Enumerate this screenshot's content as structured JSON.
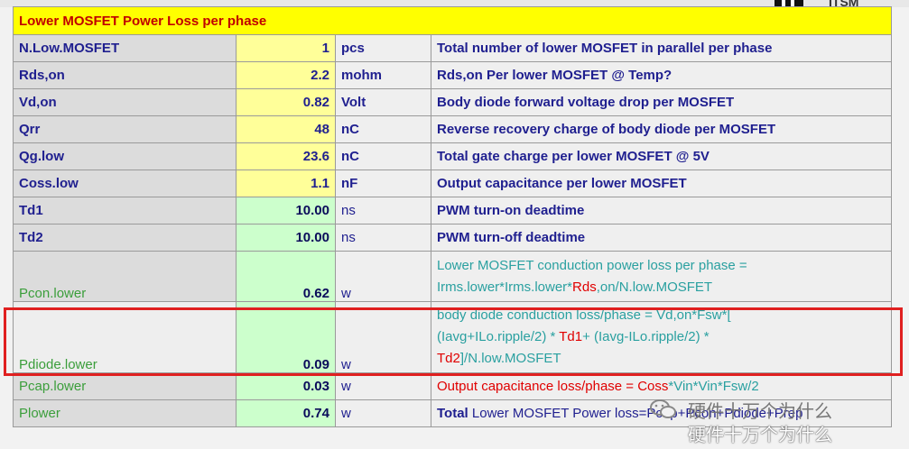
{
  "header": {
    "logo_text": "ITSM"
  },
  "table": {
    "title": "Lower MOSFET Power Loss per phase",
    "rows": [
      {
        "name": "N.Low.MOSFET",
        "value": "1",
        "unit": "pcs",
        "desc": "Total number of lower MOSFET in parallel per phase"
      },
      {
        "name": "Rds,on",
        "value": "2.2",
        "unit": "mohm",
        "desc": "Rds,on Per lower MOSFET @ Temp?"
      },
      {
        "name": "Vd,on",
        "value": "0.82",
        "unit": "Volt",
        "desc": "Body diode forward voltage drop per MOSFET"
      },
      {
        "name": "Qrr",
        "value": "48",
        "unit": "nC",
        "desc": "Reverse recovery charge of body diode per MOSFET"
      },
      {
        "name": "Qg.low",
        "value": "23.6",
        "unit": "nC",
        "desc": "Total gate charge per lower MOSFET @ 5V"
      },
      {
        "name": "Coss.low",
        "value": "1.1",
        "unit": "nF",
        "desc": "Output capacitance per lower MOSFET"
      },
      {
        "name": "Td1",
        "value": "10.00",
        "unit": "ns",
        "desc": "PWM turn-on deadtime"
      },
      {
        "name": "Td2",
        "value": "10.00",
        "unit": "ns",
        "desc": "PWM turn-off deadtime"
      }
    ],
    "pcon": {
      "name": "Pcon.lower",
      "value": "0.62",
      "unit": "w",
      "line1": "Lower MOSFET conduction power loss per phase =",
      "line2_a": "Irms.lower*Irms.lower*",
      "line2_red": "Rds",
      "line2_b": ",on/N.low.MOSFET"
    },
    "pdiode": {
      "name": "Pdiode.lower",
      "value": "0.09",
      "unit": "w",
      "line1": "body diode conduction loss/phase = Vd,on*Fsw*[",
      "line2_a": "(Iavg+ILo.ripple/2) * ",
      "line2_red": "Td1",
      "line2_b": "+ (Iavg-ILo.ripple/2) *",
      "line3_red": "Td2",
      "line3_b": "]/N.low.MOSFET"
    },
    "pcap": {
      "name": "Pcap.lower",
      "value": "0.03",
      "unit": "w",
      "desc_red": "Output capacitance loss/phase = Coss",
      "desc_b": "*Vin*Vin*Fsw/2"
    },
    "plower": {
      "name": "Plower",
      "value": "0.74",
      "unit": "w",
      "desc_bold": "Total",
      "desc_b": " Lower MOSFET Power loss=Pcap+Pcon+Pdiode+Prep"
    }
  },
  "watermark": {
    "line1": "硬件十万个为什么",
    "line2": "硬件十万个为什么"
  }
}
